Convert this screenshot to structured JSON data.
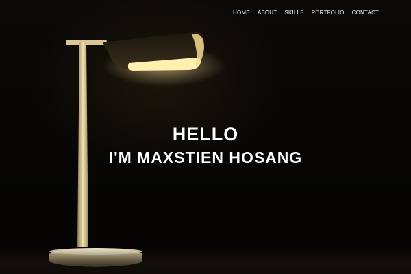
{
  "nav": {
    "items": [
      {
        "label": "HOME"
      },
      {
        "label": "ABOUT"
      },
      {
        "label": "SKILLS"
      },
      {
        "label": "PORTFOLIO"
      },
      {
        "label": "CONTACT"
      }
    ]
  },
  "hero": {
    "greeting": "HELLO",
    "intro": "I'M MAXSTIEN HOSANG",
    "background_image": "desk-lamp-icon"
  },
  "colors": {
    "background": "#050403",
    "text": "#ffffff",
    "lamp_light": "#fff0b0"
  }
}
